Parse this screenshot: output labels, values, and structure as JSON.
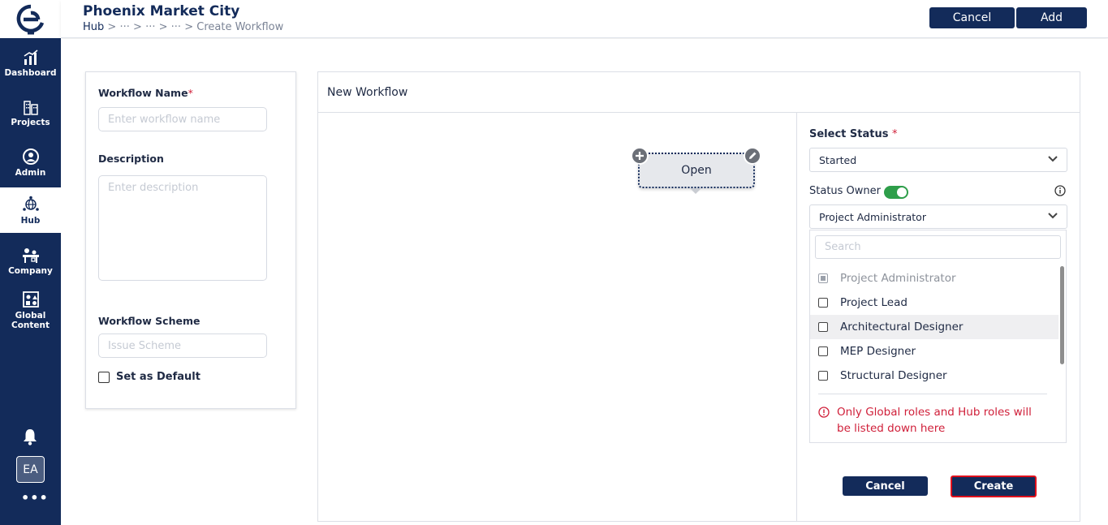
{
  "header": {
    "title": "Phoenix Market City",
    "breadcrumb": {
      "root": "Hub",
      "sep": ">",
      "ellipsis": "···",
      "current": "Create Workflow"
    },
    "cancel_label": "Cancel",
    "add_label": "Add"
  },
  "sidebar": {
    "items": [
      {
        "label": "Dashboard",
        "icon": "chart-icon"
      },
      {
        "label": "Projects",
        "icon": "buildings-icon"
      },
      {
        "label": "Admin",
        "icon": "user-gear-icon"
      },
      {
        "label": "Hub",
        "icon": "globe-network-icon",
        "active": true
      },
      {
        "label": "Company",
        "icon": "office-icon"
      },
      {
        "label": "Global Content",
        "icon": "shapes-icon"
      }
    ],
    "avatar": "EA",
    "more": "•••"
  },
  "form": {
    "workflow_name_label": "Workflow Name",
    "required_mark": "*",
    "workflow_name_placeholder": "Enter workflow name",
    "description_label": "Description",
    "description_placeholder": "Enter description",
    "scheme_label": "Workflow Scheme",
    "scheme_placeholder": "Issue Scheme",
    "set_default_label": "Set as Default"
  },
  "workflow": {
    "title": "New Workflow",
    "node_label": "Open"
  },
  "status_panel": {
    "select_status_label": "Select Status",
    "required_mark": "*",
    "selected_status": "Started",
    "status_owner_label": "Status Owner",
    "owner_selected": "Project Administrator",
    "search_placeholder": "Search",
    "options": [
      "Project Administrator",
      "Project Lead",
      "Architectural Designer",
      "MEP Designer",
      "Structural Designer"
    ],
    "warning": "Only Global roles and Hub roles will be listed down here",
    "cancel_label": "Cancel",
    "create_label": "Create"
  },
  "colors": {
    "brand_navy": "#132b5a",
    "required_red": "#d0203a",
    "toggle_green": "#2e9e4a"
  }
}
